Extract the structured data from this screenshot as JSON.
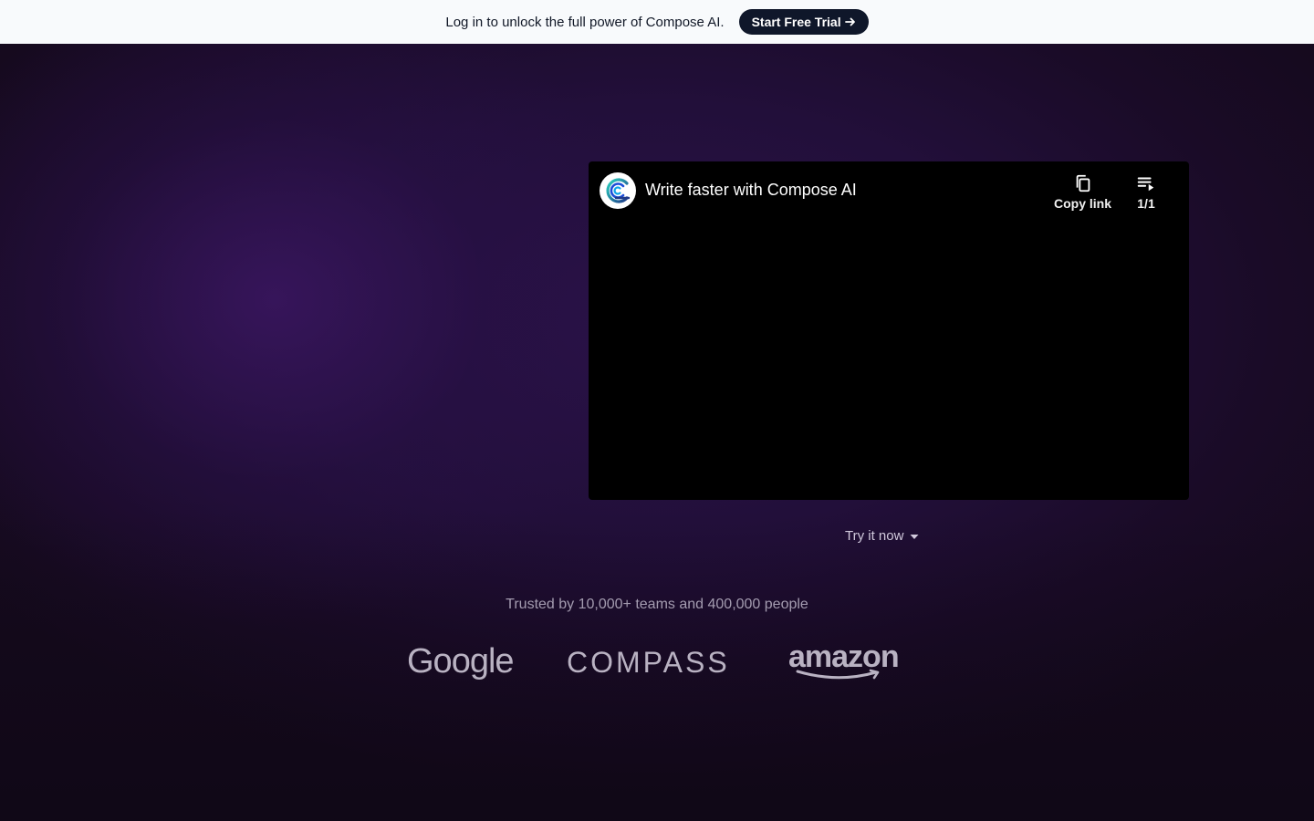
{
  "banner": {
    "text": "Log in to unlock the full power of Compose AI.",
    "cta_label": "Start Free Trial",
    "cta_icon": "arrow-right-icon"
  },
  "video": {
    "title": "Write faster with Compose AI",
    "copy_link_label": "Copy link",
    "copy_icon": "copy-icon",
    "playlist_label": "1/1",
    "playlist_icon": "playlist-icon"
  },
  "hero": {
    "try_now_label": "Try it now",
    "try_now_icon": "caret-down-icon"
  },
  "trust": {
    "text": "Trusted by 10,000+ teams and 400,000 people",
    "logos": [
      "Google",
      "COMPASS",
      "amazon"
    ]
  },
  "colors": {
    "banner_bg": "#f8fafc",
    "cta_bg": "#0f172a",
    "hero_bg": "#220f3a",
    "video_bg": "#000000",
    "logo_gray": "#b9b2c2"
  }
}
